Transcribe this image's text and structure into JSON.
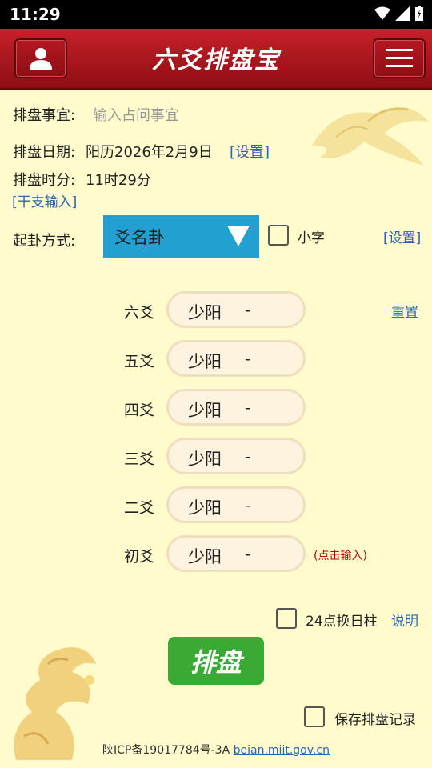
{
  "status_bar": {
    "time": "11:29"
  },
  "header": {
    "title": "六爻排盘宝"
  },
  "form": {
    "matter_label": "排盘事宜:",
    "matter_placeholder": "输入占问事宜",
    "date_label": "排盘日期:",
    "date_value": "阳历2026年2月9日",
    "date_settings_link": "[设置]",
    "time_label": "排盘时分:",
    "time_value": "11时29分",
    "ganzhi_link": "[干支输入]",
    "method_label": "起卦方式:",
    "method_value": "爻名卦",
    "small_text_label": "小字",
    "method_settings_link": "[设置]"
  },
  "yao_rows": [
    {
      "name": "六爻",
      "value": "少阳",
      "mark": "-"
    },
    {
      "name": "五爻",
      "value": "少阳",
      "mark": "-"
    },
    {
      "name": "四爻",
      "value": "少阳",
      "mark": "-"
    },
    {
      "name": "三爻",
      "value": "少阳",
      "mark": "-"
    },
    {
      "name": "二爻",
      "value": "少阳",
      "mark": "-"
    },
    {
      "name": "初爻",
      "value": "少阳",
      "mark": "-"
    }
  ],
  "reset_link": "重置",
  "click_input_hint": "(点击输入)",
  "day_pillar_label": "24点换日柱",
  "explain_link": "说明",
  "paipan_button": "排盘",
  "save_record_label": "保存排盘记录",
  "footer": {
    "icp": "陕ICP备19017784号-3A",
    "url": "beian.miit.gov.cn"
  },
  "colors": {
    "header_red": "#b51822",
    "background": "#fffbcc",
    "dropdown_blue": "#22a0d2",
    "button_green": "#3aaa35",
    "link_blue": "#2a63b8",
    "hint_red": "#c00000"
  }
}
